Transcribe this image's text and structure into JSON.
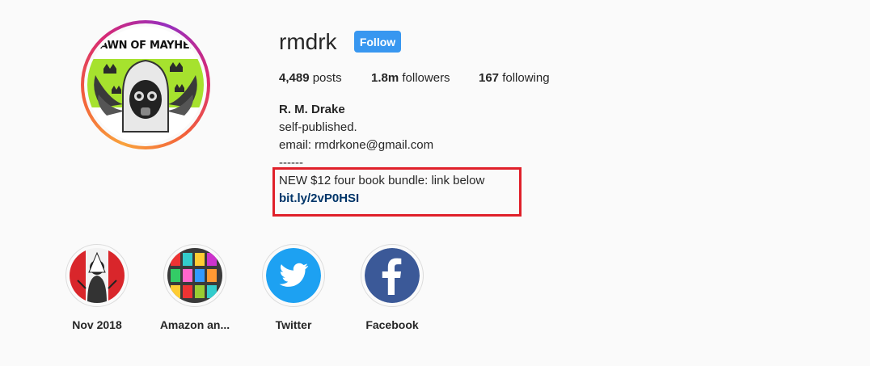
{
  "profile": {
    "username": "rmdrk",
    "follow_label": "Follow",
    "avatar_title": "DAWN OF MAYHEM",
    "stats": {
      "posts_count": "4,489",
      "posts_label": "posts",
      "followers_count": "1.8m",
      "followers_label": "followers",
      "following_count": "167",
      "following_label": "following"
    },
    "bio": {
      "full_name": "R. M. Drake",
      "line1": "self-published.",
      "line2": "email: rmdrkone@gmail.com",
      "line3": "------",
      "line4": "NEW $12 four book bundle: link below",
      "link": "bit.ly/2vP0HSI"
    }
  },
  "highlights": [
    {
      "label": "Nov 2018",
      "icon": "photo"
    },
    {
      "label": "Amazon an...",
      "icon": "photo-grid"
    },
    {
      "label": "Twitter",
      "icon": "twitter-bird-icon"
    },
    {
      "label": "Facebook",
      "icon": "facebook-f-icon"
    }
  ],
  "colors": {
    "follow_button": "#3897f0",
    "annotation_box": "#e0202a",
    "link": "#003569",
    "twitter": "#1da1f2",
    "facebook": "#3b5998"
  }
}
